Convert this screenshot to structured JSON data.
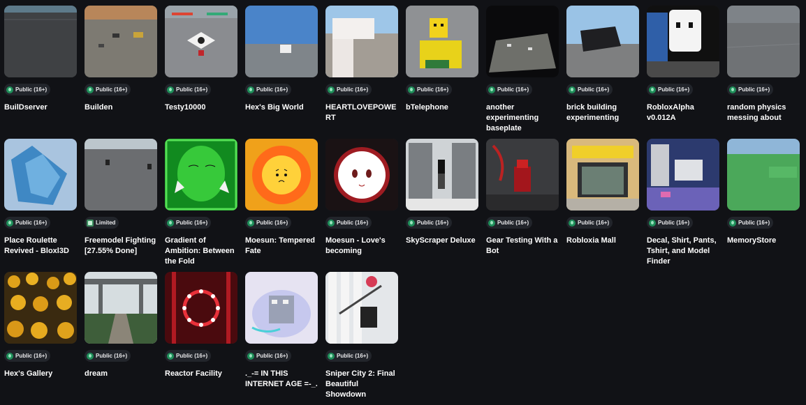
{
  "experiences": [
    {
      "title": "BuilDserver",
      "badge": "Public (16+)",
      "thumb": "dark-floor"
    },
    {
      "title": "Builden",
      "badge": "Public (16+)",
      "thumb": "sunset-track"
    },
    {
      "title": "Testy10000",
      "badge": "Public (16+)",
      "thumb": "grey-pad"
    },
    {
      "title": "Hex's Big World",
      "badge": "Public (16+)",
      "thumb": "blue-sky"
    },
    {
      "title": "HEARTLOVEPOWERT",
      "badge": "Public (16+)",
      "thumb": "white-block"
    },
    {
      "title": "bTelephone",
      "badge": "Public (16+)",
      "thumb": "noob-figure"
    },
    {
      "title": "another experimenting baseplate",
      "badge": "Public (16+)",
      "thumb": "space-plate"
    },
    {
      "title": "brick building experimenting",
      "badge": "Public (16+)",
      "thumb": "black-bricks"
    },
    {
      "title": "RobloxAlpha v0.012A",
      "badge": "Public (16+)",
      "thumb": "ghost-face"
    },
    {
      "title": "random physics messing about",
      "badge": "Public (16+)",
      "thumb": "grey-plain"
    },
    {
      "title": "Place Roulette Revived - Bloxl3D",
      "badge": "Public (16+)",
      "thumb": "blue-logo"
    },
    {
      "title": "Freemodel Fighting [27.55% Done]",
      "badge": "Limited",
      "thumb": "grey-arena"
    },
    {
      "title": "Gradient of Ambition: Between the Fold",
      "badge": "Public (16+)",
      "thumb": "green-face"
    },
    {
      "title": "Moesun: Tempered Fate",
      "badge": "Public (16+)",
      "thumb": "sun-face"
    },
    {
      "title": "Moesun - Love's becoming",
      "badge": "Public (16+)",
      "thumb": "red-ring-face"
    },
    {
      "title": "SkyScraper Deluxe",
      "badge": "Public (16+)",
      "thumb": "skyscraper"
    },
    {
      "title": "Gear Testing With a Bot",
      "badge": "Public (16+)",
      "thumb": "red-robot"
    },
    {
      "title": "Robloxia Mall",
      "badge": "Public (16+)",
      "thumb": "mall"
    },
    {
      "title": "Decal, Shirt, Pants, Tshirt, and Model Finder",
      "badge": "Public (16+)",
      "thumb": "finder"
    },
    {
      "title": "MemoryStore",
      "badge": "Public (16+)",
      "thumb": "green-field"
    },
    {
      "title": "Hex's Gallery",
      "badge": "Public (16+)",
      "thumb": "sunflowers"
    },
    {
      "title": "dream",
      "badge": "Public (16+)",
      "thumb": "shrine"
    },
    {
      "title": "Reactor Facility",
      "badge": "Public (16+)",
      "thumb": "reactor"
    },
    {
      "title": "._-= IN THIS INTERNET AGE =-_.",
      "badge": "Public (16+)",
      "thumb": "internet-age"
    },
    {
      "title": "Sniper City 2: Final Beautiful Showdown",
      "badge": "Public (16+)",
      "thumb": "sniper"
    }
  ]
}
